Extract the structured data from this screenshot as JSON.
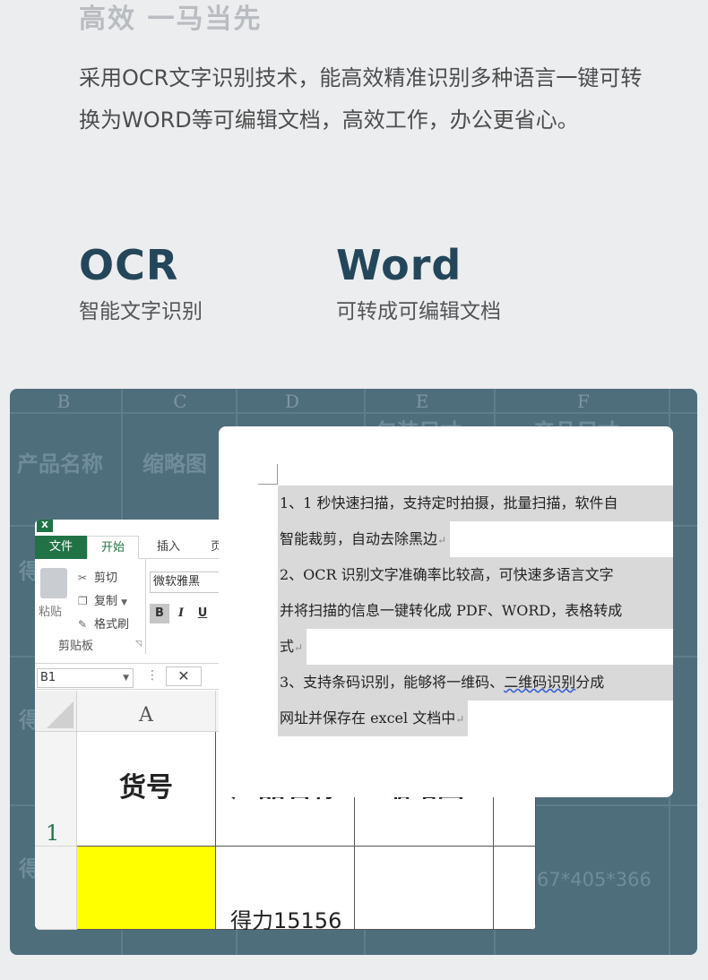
{
  "heading": "高效 一马当先",
  "description": "采用OCR文字识别技术，能高效精准识别多种语言一键可转换为WORD等可编辑文档，高效工作，办公更省心。",
  "features": [
    {
      "title": "OCR",
      "subtitle": "智能文字识别"
    },
    {
      "title": "Word",
      "subtitle": "可转成可编辑文档"
    }
  ],
  "background_sheet": {
    "columns": [
      "B",
      "C",
      "D",
      "E",
      "F"
    ],
    "header_cells": [
      "产品名称",
      "缩略图",
      "包装尺寸",
      "产品尺寸"
    ],
    "row_labels": [
      "得",
      "得",
      "得"
    ],
    "value": "67*405*366"
  },
  "excel": {
    "tabs": {
      "file": "文件",
      "home": "开始",
      "insert": "插入",
      "more": "页"
    },
    "clipboard": {
      "paste": "粘贴",
      "cut": "剪切",
      "copy": "复制",
      "format_painter": "格式刷",
      "group_label": "剪贴板"
    },
    "font_name": "微软雅黑",
    "format_buttons": {
      "bold": "B",
      "italic": "I",
      "underline": "U"
    },
    "name_box": "B1",
    "formula_dots": "⋮",
    "formula_cancel": "✕",
    "col_headers": [
      "A",
      "",
      "",
      ""
    ],
    "row_headers": [
      "1",
      ""
    ],
    "cells": {
      "a1": "货号",
      "b1": "产品名称",
      "c1": "缩略图",
      "b2": "得力15156"
    },
    "colors": {
      "accent": "#217346",
      "highlight": "#ffff00"
    }
  },
  "word": {
    "lines": [
      "1、1 秒快速扫描，支持定时拍摄，批量扫描，软件自",
      "智能裁剪，自动去除黑边",
      "2、OCR 识别文字准确率比较高，可快速多语言文字",
      "并将扫描的信息一键转化成 PDF、WORD，表格转成",
      "式",
      "3、支持条码识别，能够将一维码、",
      "二维码识别",
      "分成",
      "网址并保存在 excel 文档中"
    ],
    "paragraph_mark": "↵"
  }
}
